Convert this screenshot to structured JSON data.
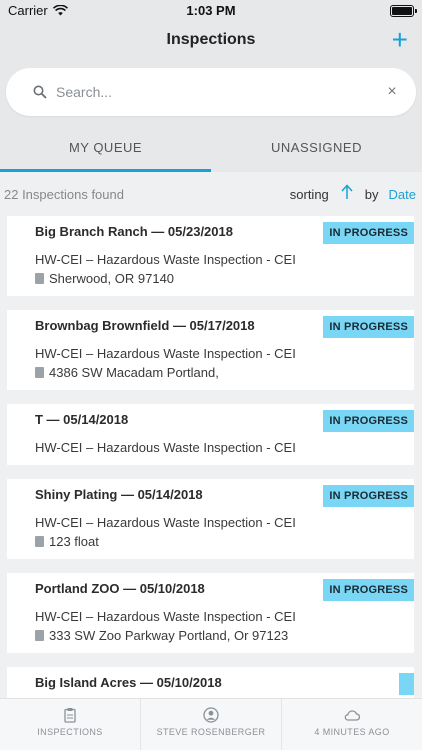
{
  "status_bar": {
    "carrier": "Carrier",
    "time": "1:03 PM"
  },
  "nav": {
    "title": "Inspections",
    "add_icon": "plus-icon"
  },
  "search": {
    "placeholder": "Search...",
    "value": ""
  },
  "tabs": [
    {
      "label": "MY QUEUE",
      "active": true
    },
    {
      "label": "UNASSIGNED",
      "active": false
    }
  ],
  "toolbar": {
    "found": "22 Inspections found",
    "sorting": "sorting",
    "by": "by",
    "sort_field": "Date"
  },
  "inspections": [
    {
      "name": "Big Branch Ranch — 05/23/2018",
      "type": "HW-CEI – Hazardous Waste Inspection - CEI",
      "address": "Sherwood, OR 97140",
      "status": "IN PROGRESS"
    },
    {
      "name": "Brownbag Brownfield — 05/17/2018",
      "type": "HW-CEI – Hazardous Waste Inspection - CEI",
      "address": "4386 SW Macadam Portland,",
      "status": "IN PROGRESS"
    },
    {
      "name": "T — 05/14/2018",
      "type": "HW-CEI – Hazardous Waste Inspection - CEI",
      "address": "",
      "status": "IN PROGRESS"
    },
    {
      "name": "Shiny Plating — 05/14/2018",
      "type": "HW-CEI – Hazardous Waste Inspection - CEI",
      "address": "123 float",
      "status": "IN PROGRESS"
    },
    {
      "name": "Portland ZOO — 05/10/2018",
      "type": "HW-CEI – Hazardous Waste Inspection - CEI",
      "address": "333 SW Zoo Parkway Portland, Or 97123",
      "status": "IN PROGRESS"
    },
    {
      "name": "Big Island Acres — 05/10/2018",
      "type": "",
      "address": "",
      "status": ""
    }
  ],
  "tabbar": [
    {
      "label": "INSPECTIONS",
      "icon": "clipboard-icon"
    },
    {
      "label": "STEVE ROSENBERGER",
      "icon": "user-icon"
    },
    {
      "label": "4 MINUTES AGO",
      "icon": "cloud-icon"
    }
  ],
  "colors": {
    "accent": "#1aa0d8",
    "badge": "#79d6f4",
    "background": "#eef0f2"
  }
}
